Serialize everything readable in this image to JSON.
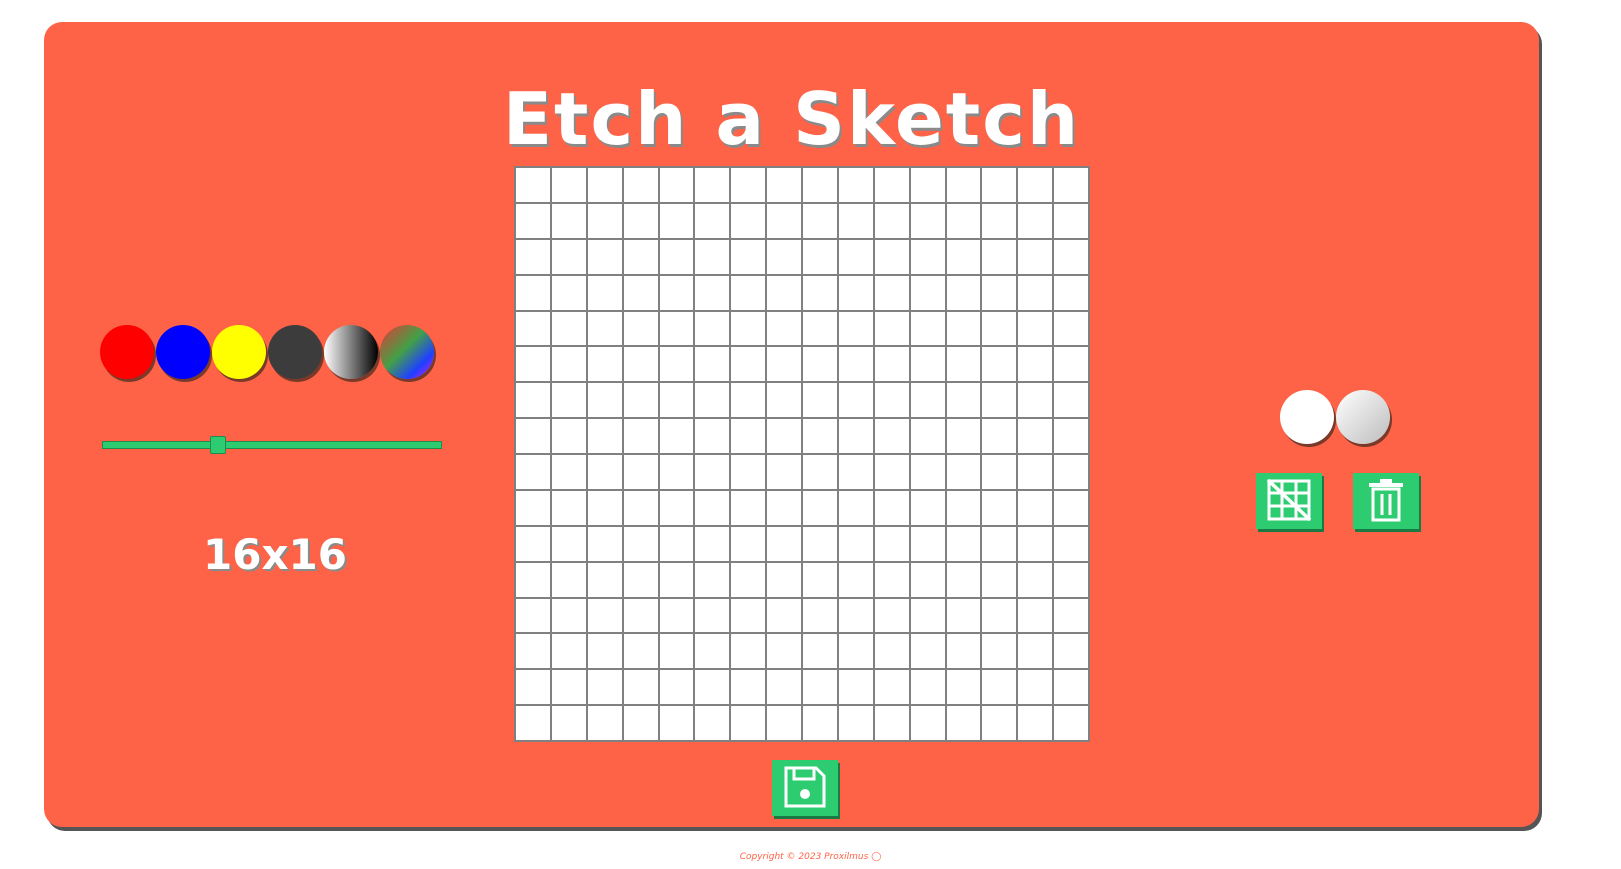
{
  "app": {
    "title": "Etch a Sketch",
    "grid_size_label": "16x16",
    "grid_columns": 16,
    "grid_rows": 16
  },
  "palette": {
    "swatches": [
      {
        "name": "red",
        "color": "#ff0000"
      },
      {
        "name": "blue",
        "color": "#0000ff"
      },
      {
        "name": "yellow",
        "color": "#ffff00"
      },
      {
        "name": "dark-gray",
        "color": "#3c3c3c"
      },
      {
        "name": "grayscale-gradient",
        "color": "linear-gradient(90deg,#ffffff,#000000)"
      },
      {
        "name": "rainbow-gradient",
        "color": "linear-gradient(135deg,#e53935,#43a047 45%,#1e40ff 75%,#d81bff)"
      }
    ]
  },
  "slider": {
    "value_fraction": 0.34
  },
  "background_options": [
    {
      "name": "white",
      "color": "#ffffff"
    },
    {
      "name": "light-gray-gradient",
      "color": "linear-gradient(135deg,#ffffff,#bdbdbd)"
    }
  ],
  "actions": {
    "toggle_grid_icon": "grid-off-icon",
    "clear_icon": "trash-icon",
    "save_icon": "floppy-disk-icon"
  },
  "colors": {
    "board": "#ff6347",
    "button": "#2ecc71"
  },
  "footer": {
    "text": "Copyright © 2023 Proxilmus"
  }
}
